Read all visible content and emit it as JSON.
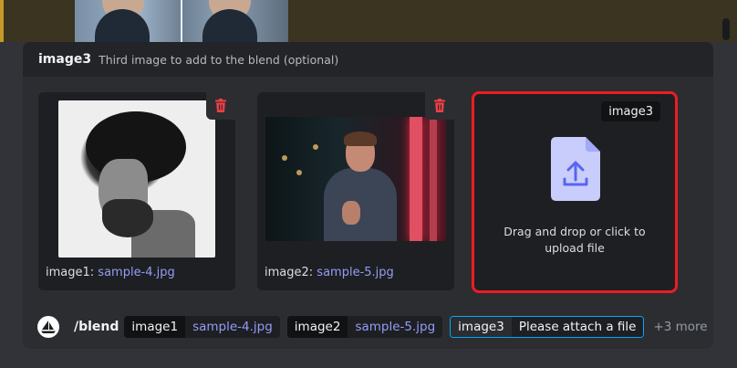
{
  "option_popout": {
    "name": "image3",
    "description": "Third image to add to the blend (optional)"
  },
  "attachments": [
    {
      "label": "image1:",
      "filename": "sample-4.jpg",
      "delete_icon": "trash-icon"
    },
    {
      "label": "image2:",
      "filename": "sample-5.jpg",
      "delete_icon": "trash-icon"
    }
  ],
  "dropzone": {
    "badge": "image3",
    "icon": "upload-file-icon",
    "text": "Drag and drop or click to upload file"
  },
  "command_bar": {
    "command": "/blend",
    "options": [
      {
        "key": "image1",
        "value": "sample-4.jpg"
      },
      {
        "key": "image2",
        "value": "sample-5.jpg"
      },
      {
        "key": "image3",
        "value": "Please attach a file"
      }
    ],
    "more": "+3 more"
  },
  "colors": {
    "accent_link": "#949cf7",
    "delete_red": "#f23f43",
    "highlight_border": "#ed1c24",
    "upload_icon": "#c9cdfb"
  }
}
